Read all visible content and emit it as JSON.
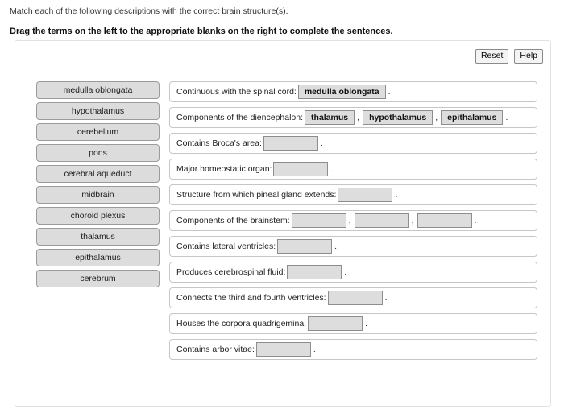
{
  "instructions": {
    "line1": "Match each of the following descriptions with the correct brain structure(s).",
    "line2": "Drag the terms on the left to the appropriate blanks on the right to complete the sentences."
  },
  "toolbar": {
    "reset_label": "Reset",
    "help_label": "Help"
  },
  "term_bank": {
    "terms": [
      {
        "label": "medulla oblongata"
      },
      {
        "label": "hypothalamus"
      },
      {
        "label": "cerebellum"
      },
      {
        "label": "pons"
      },
      {
        "label": "cerebral aqueduct"
      },
      {
        "label": "midbrain"
      },
      {
        "label": "choroid plexus"
      },
      {
        "label": "thalamus"
      },
      {
        "label": "epithalamus"
      },
      {
        "label": "cerebrum"
      }
    ]
  },
  "sentences": [
    {
      "prompt": "Continuous with the spinal cord:",
      "blanks": [
        {
          "value": "medulla oblongata",
          "filled": true
        }
      ],
      "separators": [],
      "terminator": "."
    },
    {
      "prompt": "Components of the diencephalon:",
      "blanks": [
        {
          "value": "thalamus",
          "filled": true
        },
        {
          "value": "hypothalamus",
          "filled": true
        },
        {
          "value": "epithalamus",
          "filled": true
        }
      ],
      "separators": [
        ",",
        ","
      ],
      "terminator": "."
    },
    {
      "prompt": "Contains Broca's area:",
      "blanks": [
        {
          "value": "",
          "filled": false
        }
      ],
      "separators": [],
      "terminator": "."
    },
    {
      "prompt": "Major homeostatic organ:",
      "blanks": [
        {
          "value": "",
          "filled": false
        }
      ],
      "separators": [],
      "terminator": "."
    },
    {
      "prompt": "Structure from which pineal gland extends:",
      "blanks": [
        {
          "value": "",
          "filled": false
        }
      ],
      "separators": [],
      "terminator": "."
    },
    {
      "prompt": "Components of the brainstem:",
      "blanks": [
        {
          "value": "",
          "filled": false
        },
        {
          "value": "",
          "filled": false
        },
        {
          "value": "",
          "filled": false
        }
      ],
      "separators": [
        ",",
        ","
      ],
      "terminator": "."
    },
    {
      "prompt": "Contains lateral ventricles:",
      "blanks": [
        {
          "value": "",
          "filled": false
        }
      ],
      "separators": [],
      "terminator": "."
    },
    {
      "prompt": "Produces cerebrospinal fluid:",
      "blanks": [
        {
          "value": "",
          "filled": false
        }
      ],
      "separators": [],
      "terminator": "."
    },
    {
      "prompt": "Connects the third and fourth ventricles:",
      "blanks": [
        {
          "value": "",
          "filled": false
        }
      ],
      "separators": [],
      "terminator": "."
    },
    {
      "prompt": "Houses the corpora quadrigemina:",
      "blanks": [
        {
          "value": "",
          "filled": false
        }
      ],
      "separators": [],
      "terminator": "."
    },
    {
      "prompt": "Contains arbor vitae:",
      "blanks": [
        {
          "value": "",
          "filled": false
        }
      ],
      "separators": [],
      "terminator": "."
    }
  ]
}
